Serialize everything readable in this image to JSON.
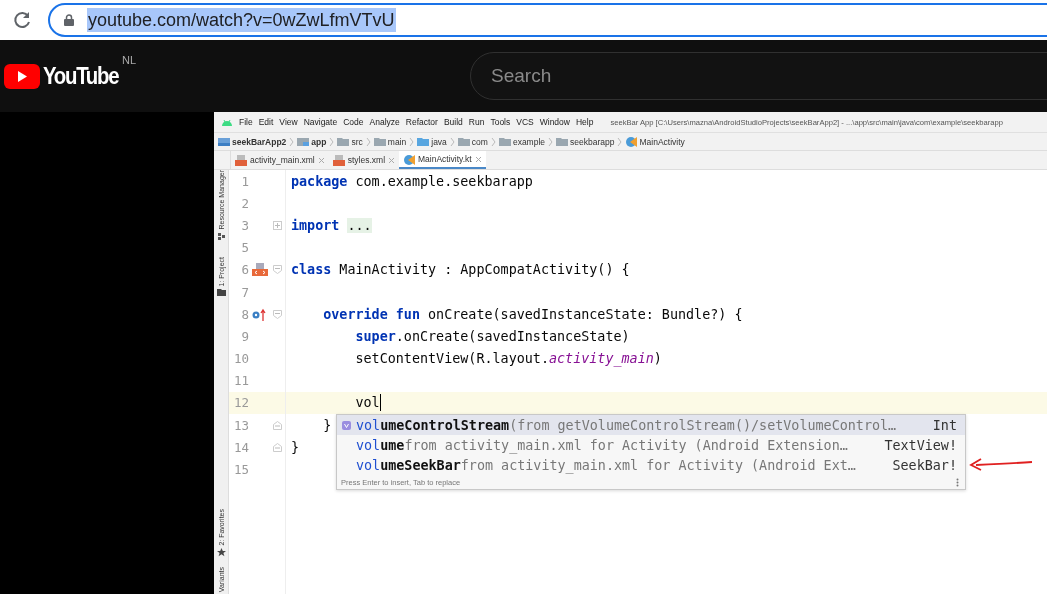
{
  "browser": {
    "url": "youtube.com/watch?v=0wZwLfmVTvU",
    "url_selected": true
  },
  "youtube": {
    "logo": "YouTube",
    "region": "NL",
    "search": {
      "placeholder": "Search"
    }
  },
  "ide": {
    "menu": [
      "File",
      "Edit",
      "View",
      "Navigate",
      "Code",
      "Analyze",
      "Refactor",
      "Build",
      "Run",
      "Tools",
      "VCS",
      "Window",
      "Help"
    ],
    "title": "seekBar App [C:\\Users\\mazna\\AndroidStudioProjects\\seekBarApp2] - ...\\app\\src\\main\\java\\com\\example\\seekbarapp",
    "breadcrumb": [
      {
        "label": "seekBarApp2",
        "kind": "project"
      },
      {
        "label": "app",
        "kind": "module"
      },
      {
        "label": "src",
        "kind": "folder"
      },
      {
        "label": "main",
        "kind": "folder"
      },
      {
        "label": "java",
        "kind": "source"
      },
      {
        "label": "com",
        "kind": "folder"
      },
      {
        "label": "example",
        "kind": "folder"
      },
      {
        "label": "seekbarapp",
        "kind": "folder"
      },
      {
        "label": "MainActivity",
        "kind": "class"
      }
    ],
    "tabs": [
      {
        "label": "activity_main.xml",
        "kind": "xml",
        "selected": false
      },
      {
        "label": "styles.xml",
        "kind": "xml",
        "selected": false
      },
      {
        "label": "MainActivity.kt",
        "kind": "class",
        "selected": true
      }
    ],
    "tool_strip": [
      {
        "label": "Resource Manager",
        "kind": "resources"
      },
      {
        "label": "1: Project",
        "kind": "folder"
      },
      {
        "label": "2: Favorites",
        "kind": "star"
      },
      {
        "label": "Variants",
        "kind": "none"
      }
    ],
    "lines": [
      {
        "number": "1",
        "tokens": [
          {
            "text": "package",
            "kind": "keyword"
          },
          {
            "text": " com.example.seekbarapp",
            "kind": "plain"
          }
        ]
      },
      {
        "number": "2"
      },
      {
        "number": "3",
        "fold": {
          "kind": "collapsed"
        },
        "tokens": [
          {
            "text": "import",
            "kind": "keyword"
          },
          {
            "text": "...",
            "kind": "folded"
          }
        ]
      },
      {
        "number": "5"
      },
      {
        "number": "6",
        "marker": {
          "kind": "layout"
        },
        "fold": {
          "kind": "open"
        },
        "tokens": [
          {
            "text": "class",
            "kind": "keyword"
          },
          {
            "text": " MainActivity : AppCompatActivity() {",
            "kind": "plain"
          }
        ]
      },
      {
        "number": "7"
      },
      {
        "number": "8",
        "marker": {
          "kind": "override"
        },
        "fold": {
          "kind": "open"
        },
        "tokens": [
          {
            "text": "    override fun",
            "kind": "keyword"
          },
          {
            "text": " onCreate(savedInstanceState: Bundle?) {",
            "kind": "plain"
          }
        ]
      },
      {
        "number": "9",
        "tokens": [
          {
            "text": "        super",
            "kind": "keyword"
          },
          {
            "text": ".onCreate(savedInstanceState)",
            "kind": "plain"
          }
        ]
      },
      {
        "number": "10",
        "tokens": [
          {
            "text": "        setContentView(R.layout.",
            "kind": "plain"
          },
          {
            "text": "activity_main",
            "kind": "field"
          },
          {
            "text": ")",
            "kind": "plain"
          }
        ]
      },
      {
        "number": "11"
      },
      {
        "number": "12",
        "current": true,
        "caret": true,
        "tokens": [
          {
            "text": "        vol",
            "kind": "plain"
          }
        ]
      },
      {
        "number": "13",
        "fold": {
          "kind": "end"
        },
        "tokens": [
          {
            "text": "    }",
            "kind": "plain"
          }
        ]
      },
      {
        "number": "14",
        "fold": {
          "kind": "end"
        },
        "tokens": [
          {
            "text": "}",
            "kind": "plain"
          }
        ]
      },
      {
        "number": "15"
      }
    ],
    "completion": {
      "items": [
        {
          "kind": "variable",
          "match": "vol",
          "rest": "umeControlStream",
          "detail": "(from getVolumeControlStream()/setVolumeControl…",
          "type": "Int",
          "selected": true
        },
        {
          "kind": "none",
          "match": "vol",
          "rest": "ume",
          "detail": "from activity_main.xml for Activity (Android Extension…",
          "type": "TextView!",
          "selected": false
        },
        {
          "kind": "none",
          "match": "vol",
          "rest": "umeSeekBar",
          "detail": "from activity_main.xml for Activity (Android Ext…",
          "type": "SeekBar!",
          "selected": false
        }
      ],
      "hint": "Press Enter to insert, Tab to replace"
    },
    "annotation": {
      "kind": "arrow"
    }
  }
}
